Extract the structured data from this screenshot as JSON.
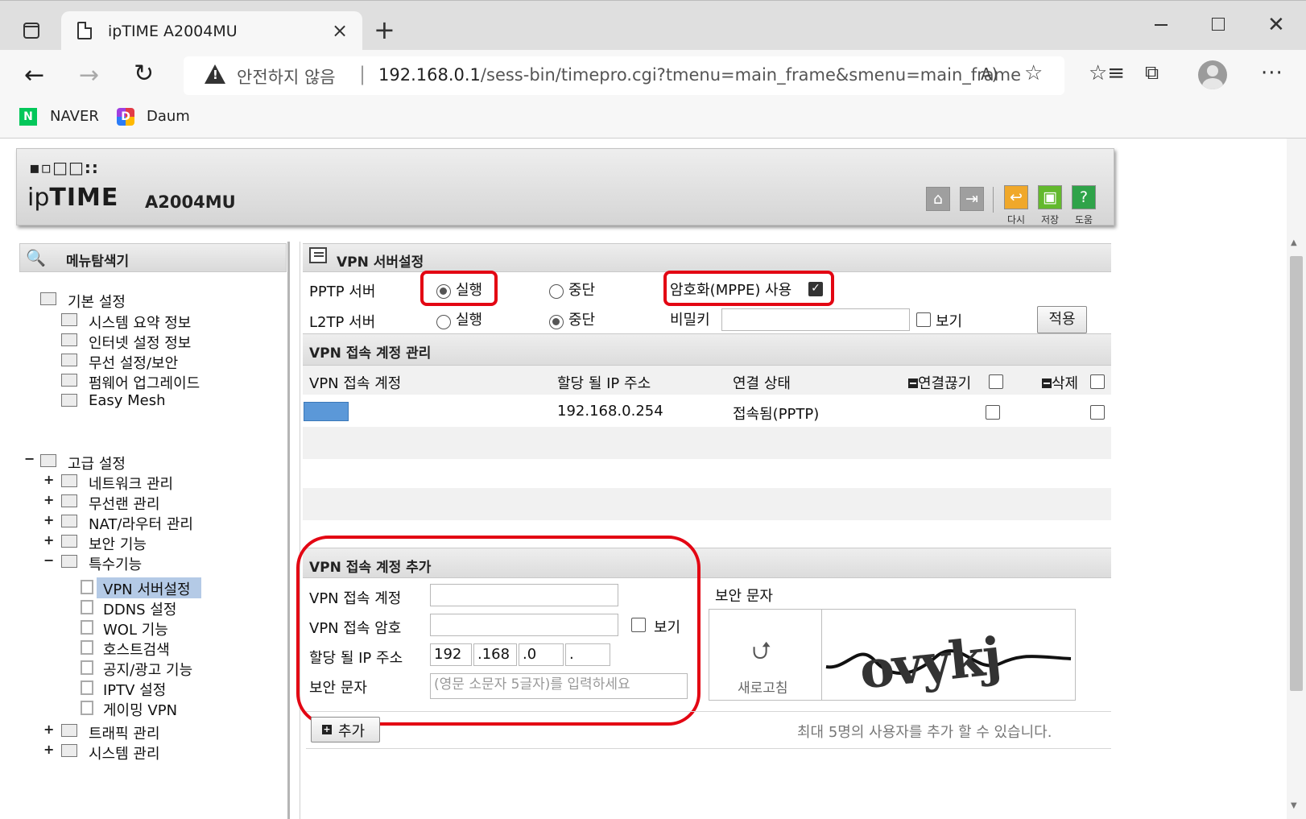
{
  "browser": {
    "tab_title": "ipTIME A2004MU",
    "insecure_label": "안전하지 않음",
    "url_host": "192.168.0.1",
    "url_path": "/sess-bin/timepro.cgi?tmenu=main_frame&smenu=main_frame",
    "bookmarks": [
      {
        "label": "NAVER",
        "icon_letter": "N"
      },
      {
        "label": "Daum",
        "icon_letter": "D"
      }
    ],
    "icons": {
      "back": "←",
      "forward": "→",
      "reload": "↻",
      "tab_close": "×",
      "new_tab": "+",
      "read_aloud": "A)",
      "add_favorite": "☆",
      "favorites": "☆≡",
      "collections": "⧉",
      "more": "···",
      "win_close": "✕",
      "separator": "|",
      "warn_mark": "!"
    }
  },
  "router": {
    "logo_dots": "▪▫□□::",
    "logo_ip": "ip",
    "logo_time": "TIME",
    "model": "A2004MU",
    "header_buttons": [
      {
        "label": "다시",
        "icon": "↩",
        "color": "#f0a82a"
      },
      {
        "label": "저장",
        "icon": "▣",
        "color": "#63b92d"
      },
      {
        "label": "도움",
        "icon": "?",
        "color": "#2fa349"
      }
    ],
    "home_icon": "⌂",
    "logout_icon": "⇥"
  },
  "menu": {
    "title": "메뉴탐색기",
    "search_icon": "🔍",
    "basic": {
      "label": "기본 설정",
      "items": [
        "시스템 요약 정보",
        "인터넷 설정 정보",
        "무선 설정/보안",
        "펌웨어 업그레이드",
        "Easy Mesh"
      ]
    },
    "advanced": {
      "label": "고급 설정",
      "toggle": "−",
      "groups": [
        {
          "label": "네트워크 관리",
          "toggle": "+"
        },
        {
          "label": "무선랜 관리",
          "toggle": "+"
        },
        {
          "label": "NAT/라우터 관리",
          "toggle": "+"
        },
        {
          "label": "보안 기능",
          "toggle": "+"
        },
        {
          "label": "특수기능",
          "toggle": "−"
        }
      ],
      "special_items": [
        "VPN 서버설정",
        "DDNS 설정",
        "WOL 기능",
        "호스트검색",
        "공지/광고 기능",
        "IPTV 설정",
        "게이밍 VPN"
      ],
      "active_item": "VPN 서버설정",
      "tail_groups": [
        {
          "label": "트래픽 관리",
          "toggle": "+"
        },
        {
          "label": "시스템 관리",
          "toggle": "+"
        }
      ]
    }
  },
  "vpn": {
    "section_title": "VPN 서버설정",
    "pptp_label": "PPTP 서버",
    "l2tp_label": "L2TP 서버",
    "run_label": "실행",
    "stop_label": "중단",
    "pptp_state": "실행",
    "l2tp_state": "중단",
    "mppe_label": "암호화(MPPE) 사용",
    "mppe_checked": true,
    "check_mark": "✓",
    "secret_label": "비밀키",
    "secret_value": "",
    "show_label": "보기",
    "apply_label": "적용"
  },
  "accounts": {
    "section_title": "VPN 접속 계정 관리",
    "columns": [
      "VPN 접속 계정",
      "할당 될 IP 주소",
      "연결 상태",
      "연결끊기",
      "삭제"
    ],
    "rows": [
      {
        "account": "",
        "ip": "192.168.0.254",
        "status": "접속됨(PPTP)"
      }
    ]
  },
  "add": {
    "section_title": "VPN 접속 계정 추가",
    "account_label": "VPN 접속 계정",
    "account_value": "",
    "password_label": "VPN 접속 암호",
    "password_value": "",
    "show_label": "보기",
    "ip_label": "할당 될 IP 주소",
    "ip_parts": [
      "192",
      ".168",
      ".0",
      "."
    ],
    "captcha_label": "보안 문자",
    "captcha_input_label": "보안 문자",
    "captcha_placeholder": "(영문 소문자 5글자)를 입력하세요",
    "captcha_refresh_label": "새로고침",
    "captcha_refresh_icon": "⮍",
    "captcha_text": "ovykj",
    "add_button": "추가",
    "add_plus": "+",
    "max_note": "최대 5명의 사용자를 추가 할 수 있습니다."
  },
  "colors": {
    "highlight_red": "#e30613",
    "active_menu_bg": "#b4cae6",
    "account_swatch": "#5b98d8"
  }
}
